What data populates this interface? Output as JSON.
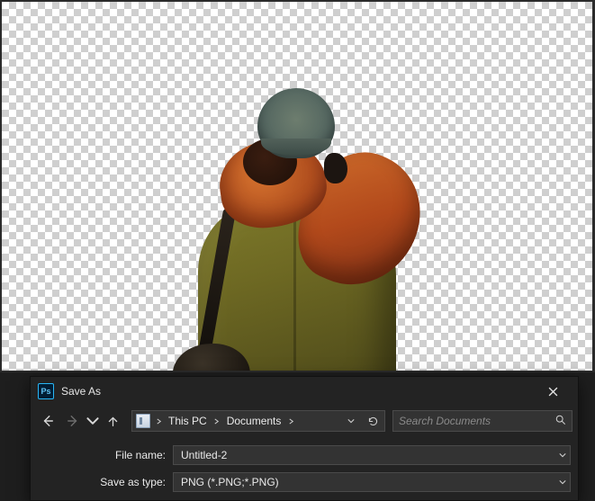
{
  "dialog": {
    "title": "Save As",
    "breadcrumb": {
      "root": "This PC",
      "folder": "Documents"
    },
    "search": {
      "placeholder": "Search Documents"
    },
    "filename": {
      "label": "File name:",
      "value": "Untitled-2"
    },
    "filetype": {
      "label": "Save as type:",
      "value": "PNG (*.PNG;*.PNG)"
    }
  }
}
